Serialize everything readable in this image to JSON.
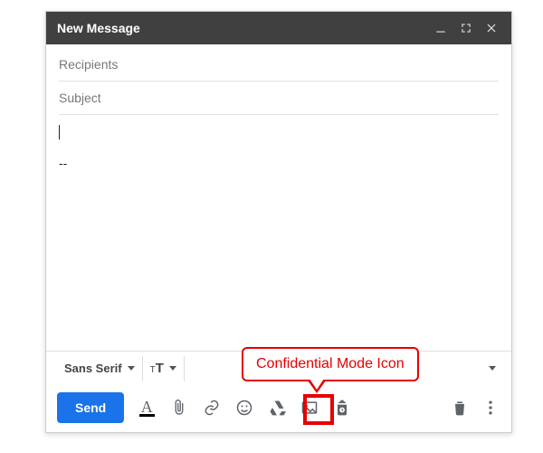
{
  "titlebar": {
    "title": "New Message"
  },
  "fields": {
    "recipients_placeholder": "Recipients",
    "subject_placeholder": "Subject"
  },
  "body": {
    "text": "",
    "signature_sep": "--"
  },
  "format_bar": {
    "font_name": "Sans Serif",
    "size_label": "T"
  },
  "actions": {
    "send_label": "Send"
  },
  "annotation": {
    "label": "Confidential Mode Icon"
  }
}
